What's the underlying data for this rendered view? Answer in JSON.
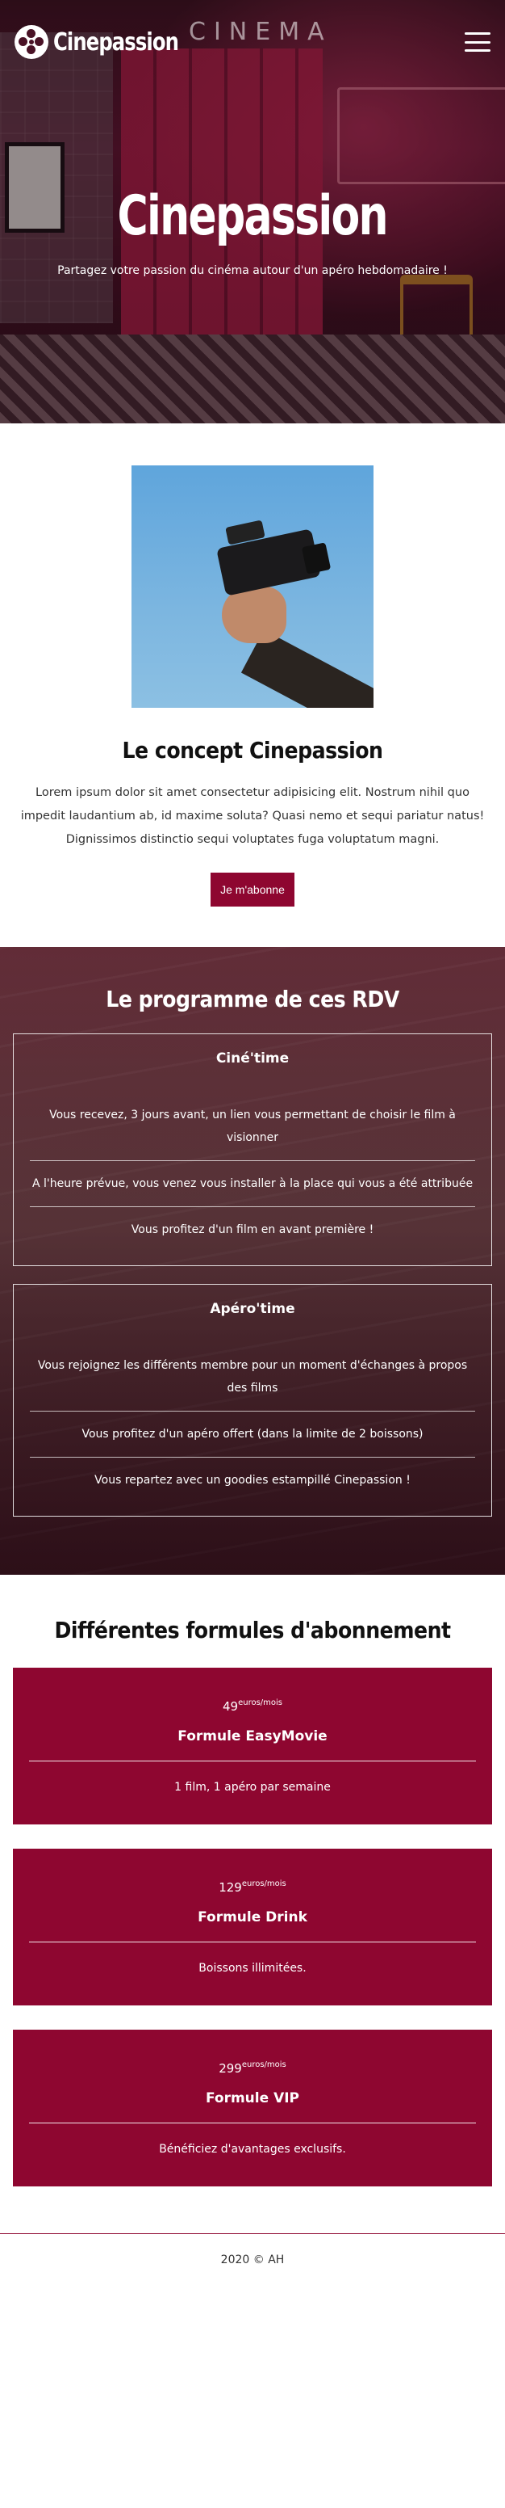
{
  "header": {
    "brand": "Cinepassion",
    "sign_text": "CINEMA",
    "menu_icon": "hamburger-icon"
  },
  "hero": {
    "title": "Cinepassion",
    "subtitle": "Partagez votre passion du cinéma autour d'un apéro hebdomadaire !"
  },
  "concept": {
    "title": "Le concept Cinepassion",
    "text": "Lorem ipsum dolor sit amet consectetur adipisicing elit. Nostrum nihil quo impedit laudantium ab, id maxime soluta? Quasi nemo et sequi pariatur natus! Dignissimos distinctio sequi voluptates fuga voluptatum magni.",
    "button_label": "Je m'abonne"
  },
  "programme": {
    "title": "Le programme de ces RDV",
    "cards": [
      {
        "title": "Ciné'time",
        "items": [
          "Vous recevez, 3 jours avant, un lien vous permettant de choisir le film à visionner",
          "A l'heure prévue, vous venez vous installer à la place qui vous a été attribuée",
          "Vous profitez d'un film en avant première !"
        ]
      },
      {
        "title": "Apéro'time",
        "items": [
          "Vous rejoignez les différents membre pour un moment d'échanges à propos des films",
          "Vous profitez d'un apéro offert (dans la limite de 2 boissons)",
          "Vous repartez avec un goodies estampillé Cinepassion !"
        ]
      }
    ]
  },
  "formules": {
    "title": "Différentes formules d'abonnement",
    "plans": [
      {
        "price": "49",
        "unit": "euros/mois",
        "name": "Formule EasyMovie",
        "desc": "1 film, 1 apéro par semaine"
      },
      {
        "price": "129",
        "unit": "euros/mois",
        "name": "Formule Drink",
        "desc": "Boissons illimitées."
      },
      {
        "price": "299",
        "unit": "euros/mois",
        "name": "Formule VIP",
        "desc": "Bénéficiez d'avantages exclusifs."
      }
    ]
  },
  "footer": {
    "text": "2020 © AH"
  },
  "colors": {
    "accent": "#8e0630"
  }
}
